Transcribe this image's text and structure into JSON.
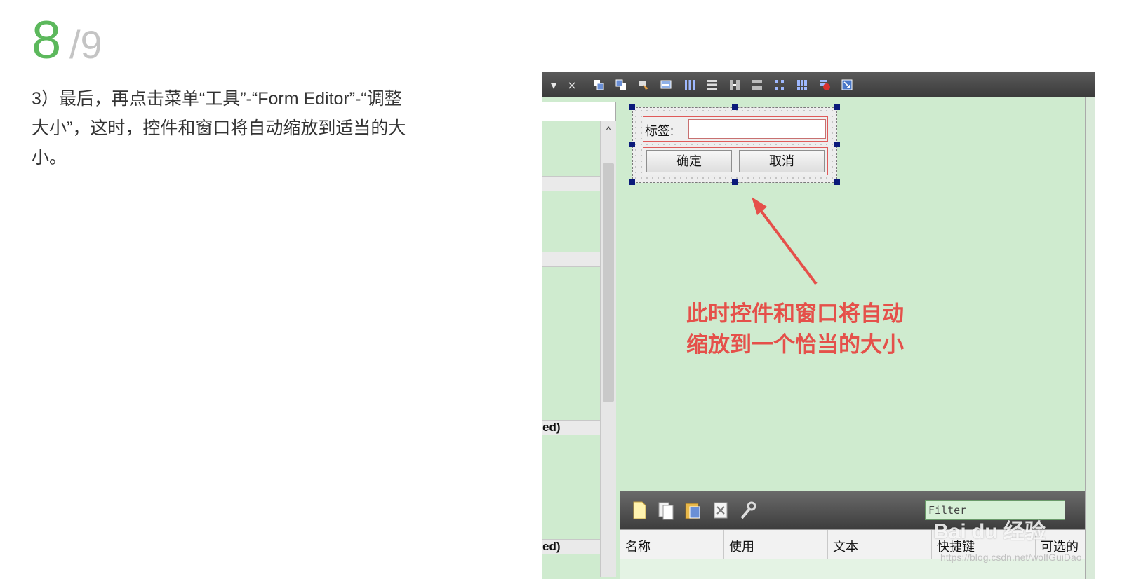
{
  "step": {
    "number": "8",
    "total": "/9"
  },
  "instruction": "3）最后，再点击菜单“工具”-“Form Editor”-“调整大小”，这时，控件和窗口将自动缩放到适当的大小。",
  "screenshot": {
    "toolbar": {
      "dropdown_glyph": "▾",
      "close_glyph": "×"
    },
    "left_panel": {
      "row_labels": [
        "ed)",
        "ed)"
      ],
      "scroll_up_glyph": "^"
    },
    "form": {
      "label_text": "标签:",
      "ok_button": "确定",
      "cancel_button": "取消"
    },
    "annotation": {
      "line1": "此时控件和窗口将自动",
      "line2": "缩放到一个恰当的大小",
      "color": "#e5504a"
    },
    "filter": {
      "placeholder": "Filter"
    },
    "columns": [
      "名称",
      "使用",
      "文本",
      "快捷键",
      "可选的"
    ]
  },
  "watermark": {
    "brand": "Bai du 经验",
    "url": "https://blog.csdn.net/wolfGuiDao"
  },
  "colors": {
    "accent_green": "#5cb85c",
    "canvas_green": "#cfebcf"
  }
}
